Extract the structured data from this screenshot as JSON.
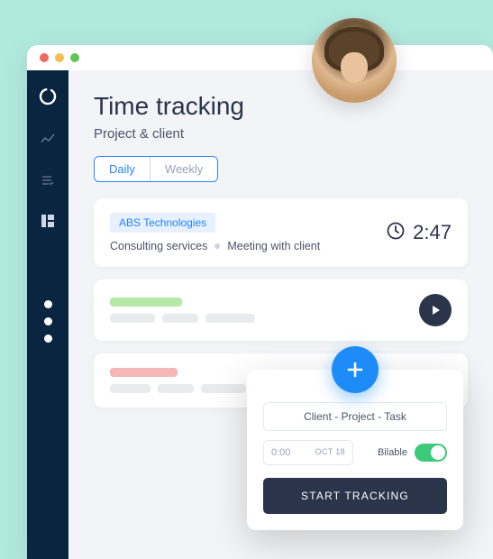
{
  "header": {
    "title": "Time tracking",
    "subtitle": "Project & client"
  },
  "tabs": {
    "daily": "Daily",
    "weekly": "Weekly"
  },
  "entry": {
    "client_chip": "ABS Technologies",
    "project": "Consulting services",
    "task": "Meeting with client",
    "time": "2:47"
  },
  "popup": {
    "selector": "Client  -  Project  -  Task",
    "time_placeholder": "0:00",
    "date": "OCT 18",
    "billable_label": "Bilable",
    "start_button": "START TRACKING"
  }
}
